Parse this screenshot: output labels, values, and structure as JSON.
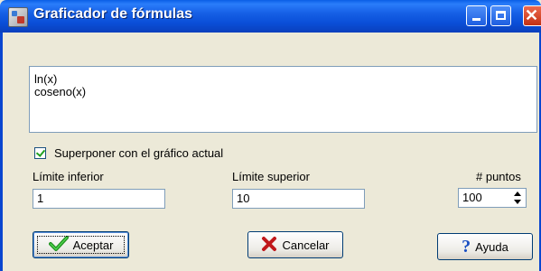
{
  "window": {
    "title": "Graficador de fórmulas"
  },
  "formulas": [
    "ln(x)",
    "coseno(x)"
  ],
  "overlay": {
    "label": "Superponer con el gráfico actual",
    "checked": true
  },
  "lower_limit": {
    "label": "Límite inferior",
    "value": "1"
  },
  "upper_limit": {
    "label": "Límite superior",
    "value": "10"
  },
  "points": {
    "label": "# puntos",
    "value": "100"
  },
  "buttons": {
    "accept": "Aceptar",
    "cancel": "Cancelar",
    "help": "Ayuda"
  },
  "icons": {
    "accept": "green-check-icon",
    "cancel": "red-x-icon",
    "help": "blue-question-icon"
  },
  "colors": {
    "titlebar": "#0a4fd8",
    "dialog_bg": "#ece9d8",
    "close_button": "#c33113"
  }
}
